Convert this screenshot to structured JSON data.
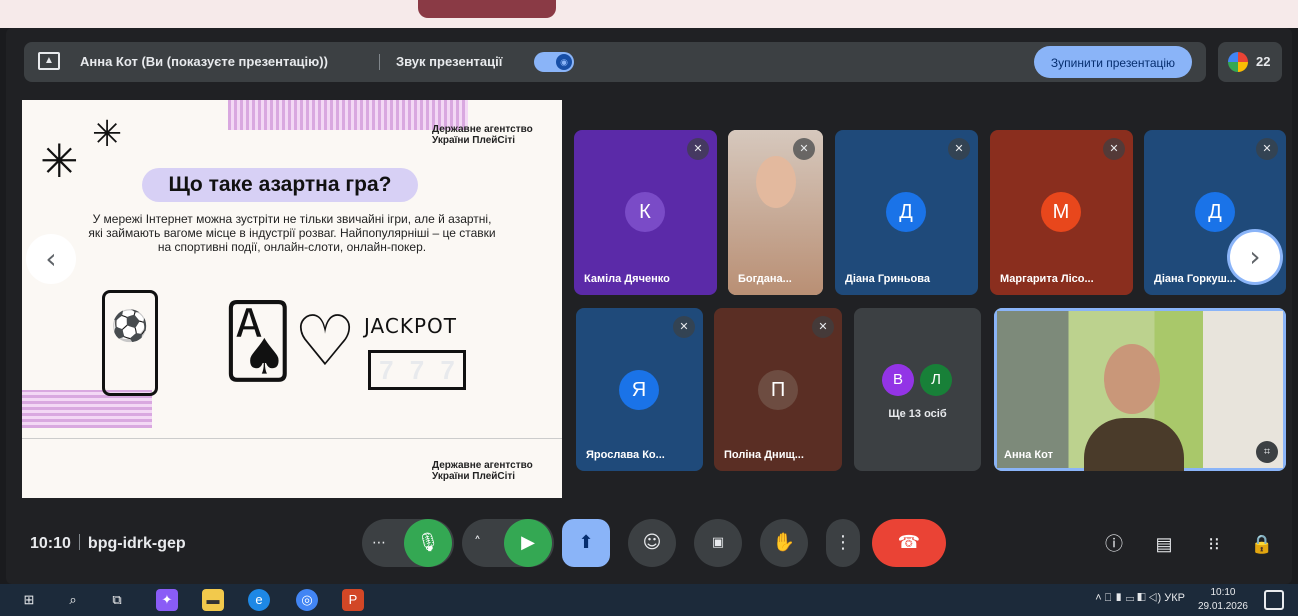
{
  "presenter_bar": {
    "text": "Анна Кот (Ви (показуєте презентацію))",
    "sound_label": "Звук презентації",
    "stop_button": "Зупинити презентацію",
    "participants_count": "22"
  },
  "slide": {
    "agency_top": "Державне агентство України ПлейСіті",
    "title": "Що таке азартна гра?",
    "body": "У мережі Інтернет можна зустріти не тільки звичайні ігри, але й азартні, які займають вагоме місце в індустрії розваг. Найпопулярніші – це ставки на спортивні події, онлайн-слоти, онлайн-покер.",
    "jackpot": "JACKPOT",
    "slot_digits": [
      "7",
      "7",
      "7"
    ],
    "agency_bottom": "Державне агентство України ПлейСіті"
  },
  "tiles": [
    {
      "initial": "К",
      "name": "Каміла Дяченко"
    },
    {
      "initial": "",
      "name": "Богдана..."
    },
    {
      "initial": "Д",
      "name": "Діана Гриньова"
    },
    {
      "initial": "М",
      "name": "Маргарита Лісо..."
    },
    {
      "initial": "Д",
      "name": "Діана Горкуш..."
    },
    {
      "initial": "Я",
      "name": "Ярослава Ко..."
    },
    {
      "initial": "П",
      "name": "Поліна Днищ..."
    },
    {
      "initial": "",
      "name": "Анна Кот"
    }
  ],
  "more": {
    "initials": [
      "В",
      "Л"
    ],
    "label": "Ще 13 осіб"
  },
  "meeting": {
    "time": "10:10",
    "code": "bpg-idrk-gep"
  },
  "taskbar": {
    "lang": "УКР",
    "time": "10:10",
    "date": "29.01.2026"
  },
  "colors": {
    "tile_purple": "#5b2aa8",
    "tile_blue": "#1f4a7a",
    "tile_red": "#8a2e1e",
    "tile_brown": "#5a2e24",
    "mic_green": "#34a853",
    "end_red": "#ea4335",
    "present_blue": "#8ab4f8"
  }
}
